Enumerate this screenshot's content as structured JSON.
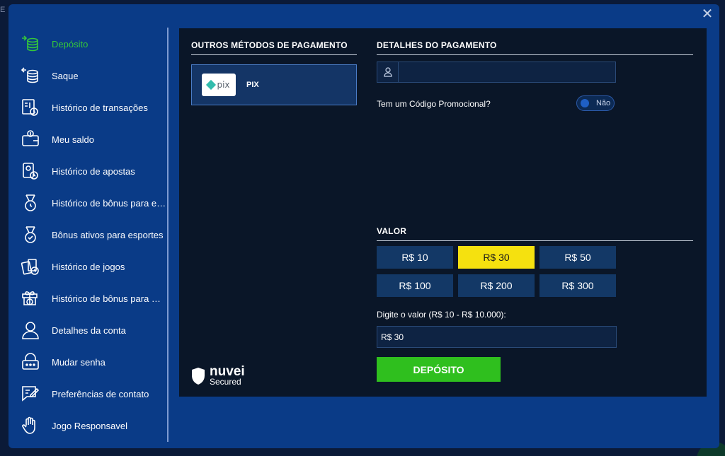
{
  "backdrop": {
    "corner_text": "E"
  },
  "modal": {
    "close_symbol": "✕"
  },
  "sidebar": {
    "items": [
      {
        "label": "Depósito",
        "icon": "coins-deposit-icon",
        "active": true
      },
      {
        "label": "Saque",
        "icon": "coins-withdraw-icon"
      },
      {
        "label": "Histórico de transações",
        "icon": "transaction-history-icon"
      },
      {
        "label": "Meu saldo",
        "icon": "wallet-icon"
      },
      {
        "label": "Histórico de apostas",
        "icon": "bet-history-icon"
      },
      {
        "label": "Histórico de bônus para es...",
        "icon": "sports-bonus-history-icon"
      },
      {
        "label": "Bônus ativos para esportes",
        "icon": "medal-check-icon"
      },
      {
        "label": "Histórico de jogos",
        "icon": "cards-history-icon"
      },
      {
        "label": "Histórico de bônus para Ca...",
        "icon": "gift-history-icon"
      },
      {
        "label": "Detalhes da conta",
        "icon": "user-icon"
      },
      {
        "label": "Mudar senha",
        "icon": "lock-icon"
      },
      {
        "label": "Preferências de contato",
        "icon": "chat-edit-icon"
      },
      {
        "label": "Jogo Responsavel",
        "icon": "hand-icon"
      }
    ]
  },
  "payment_methods": {
    "title": "OUTROS MÉTODOS DE PAGAMENTO",
    "methods": [
      {
        "logo_text": "pix",
        "label": "PIX",
        "icon": "pix-logo-icon"
      }
    ]
  },
  "payment_details": {
    "title": "DETALHES DO PAGAMENTO",
    "user_input": {
      "value": "",
      "placeholder": ""
    },
    "promo_question": "Tem um Código Promocional?",
    "promo_toggle": "Não"
  },
  "amount": {
    "title": "VALOR",
    "options": [
      "R$ 10",
      "R$ 30",
      "R$ 50",
      "R$ 100",
      "R$ 200",
      "R$ 300"
    ],
    "selected": "R$ 30",
    "range_label": "Digite o valor (R$ 10 - R$ 10.000):",
    "value": "R$ 30",
    "submit_label": "DEPÓSITO"
  },
  "security": {
    "brand": "nuvei",
    "sub": "Secured"
  },
  "colors": {
    "accent_green": "#35c83a",
    "selected_yellow": "#f5e10f",
    "deposit_green": "#2fbf1e",
    "modal_blue": "#0a3b87",
    "panel_dark": "#0a1628"
  }
}
